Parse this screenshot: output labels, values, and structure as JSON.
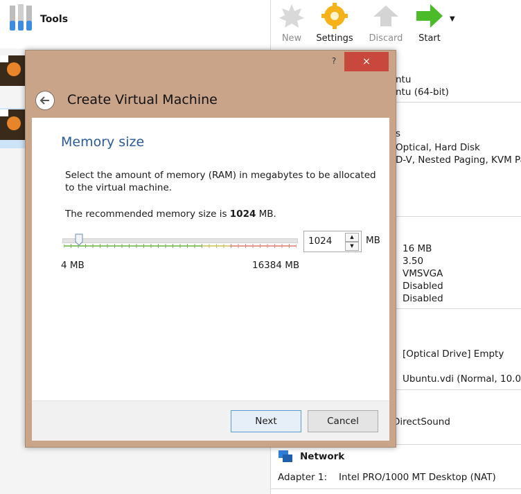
{
  "app": {
    "tools_label": "Tools",
    "toolbar": [
      {
        "label": "New",
        "enabled": false
      },
      {
        "label": "Settings",
        "enabled": true
      },
      {
        "label": "Discard",
        "enabled": false
      },
      {
        "label": "Start",
        "enabled": true
      }
    ]
  },
  "details": {
    "general_line1": "ntu",
    "general_line2": "ntu (64-bit)",
    "system_line0": "s",
    "system_line1": "Optical, Hard Disk",
    "system_line2": "D-V, Nested Paging, KVM Pa",
    "display_values": [
      "16 MB",
      "3.50",
      "VMSVGA",
      "Disabled",
      "Disabled"
    ],
    "storage_optical": "[Optical Drive] Empty",
    "storage_disk": "Ubuntu.vdi (Normal, 10.00",
    "audio_driver": "DirectSound",
    "network_title": "Network",
    "network_adapter_label": "Adapter 1:",
    "network_adapter_value": "Intel PRO/1000 MT Desktop (NAT)"
  },
  "dialog": {
    "help_label": "?",
    "close_label": "×",
    "title": "Create Virtual Machine",
    "heading": "Memory size",
    "description": "Select the amount of memory (RAM) in megabytes to be allocated to the virtual machine.",
    "recommend_prefix": "The recommended memory size is ",
    "recommend_value": "1024",
    "recommend_suffix": " MB.",
    "memory_value": "1024",
    "unit": "MB",
    "slider_min_label": "4 MB",
    "slider_max_label": "16384 MB",
    "next_label": "Next",
    "cancel_label": "Cancel"
  },
  "colors": {
    "dialog_frame": "#c9a489",
    "close_button": "#c9483e",
    "heading": "#2a5a9a",
    "primary_button_border": "#5b9bd5"
  }
}
